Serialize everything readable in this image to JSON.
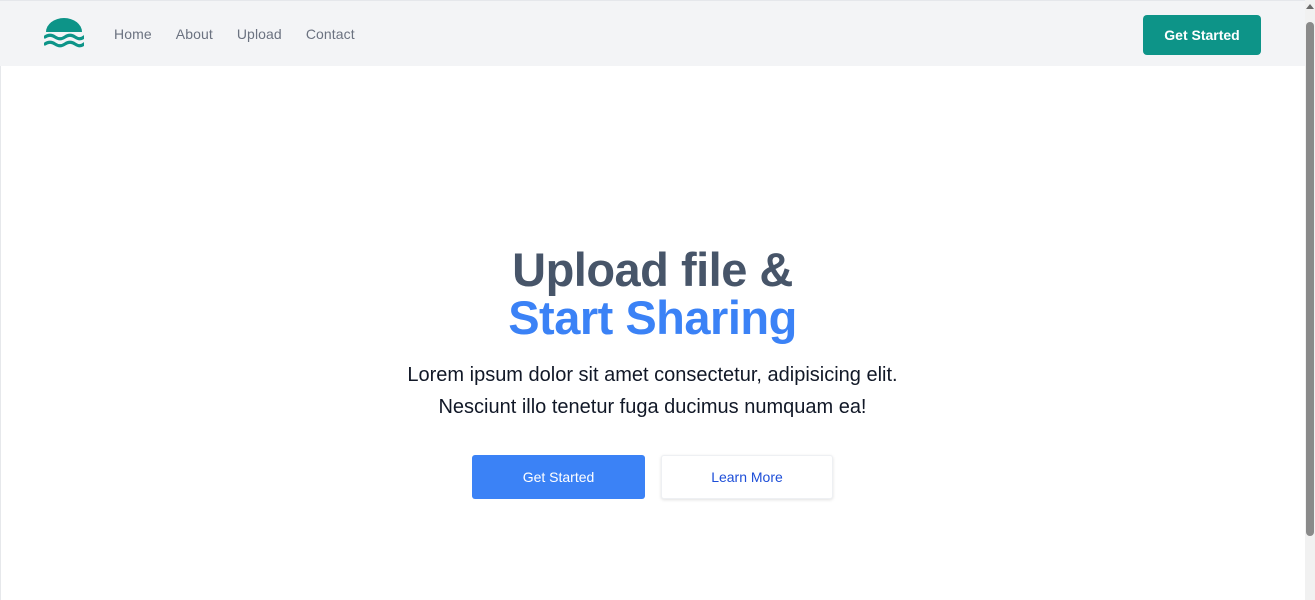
{
  "header": {
    "logo_icon": "waves-sun-logo-icon",
    "nav": [
      {
        "label": "Home"
      },
      {
        "label": "About"
      },
      {
        "label": "Upload"
      },
      {
        "label": "Contact"
      }
    ],
    "cta_label": "Get Started"
  },
  "hero": {
    "title_line1": "Upload file &",
    "title_line2": "Start Sharing",
    "subtitle_line1": "Lorem ipsum dolor sit amet consectetur, adipisicing elit.",
    "subtitle_line2": "Nesciunt illo tenetur fuga ducimus numquam ea!",
    "primary_button": "Get Started",
    "secondary_button": "Learn More"
  },
  "colors": {
    "brand_teal": "#0d9488",
    "accent_blue": "#3b82f6",
    "heading_slate": "#475569",
    "header_bg": "#f3f4f6"
  }
}
